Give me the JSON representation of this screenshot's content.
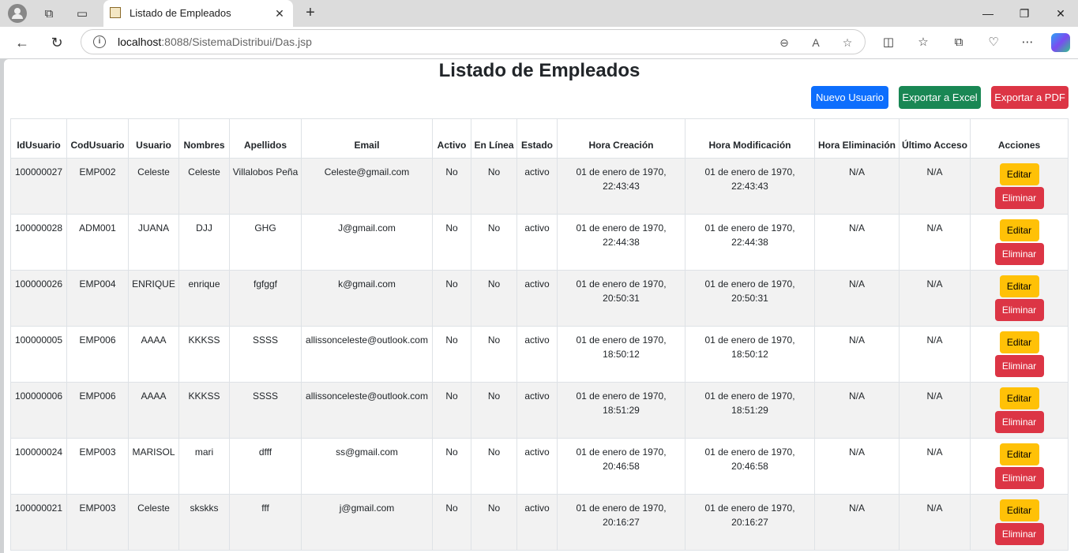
{
  "browser": {
    "tab_title": "Listado de Empleados",
    "new_tab": "+",
    "url_host": "localhost",
    "url_rest": ":8088/SistemaDistribui/Das.jsp"
  },
  "page": {
    "heading": "Listado de Empleados",
    "buttons": {
      "nuevo": "Nuevo Usuario",
      "excel": "Exportar a Excel",
      "pdf": "Exportar a PDF"
    },
    "columns": [
      "IdUsuario",
      "CodUsuario",
      "Usuario",
      "Nombres",
      "Apellidos",
      "Email",
      "Activo",
      "En Línea",
      "Estado",
      "Hora Creación",
      "Hora Modificación",
      "Hora Eliminación",
      "Último Acceso",
      "Acciones"
    ],
    "action_labels": {
      "edit": "Editar",
      "delete": "Eliminar"
    },
    "rows": [
      [
        "100000027",
        "EMP002",
        "Celeste",
        "Celeste",
        "Villalobos Peña",
        "Celeste@gmail.com",
        "No",
        "No",
        "activo",
        "01 de enero de 1970, 22:43:43",
        "01 de enero de 1970, 22:43:43",
        "N/A",
        "N/A"
      ],
      [
        "100000028",
        "ADM001",
        "JUANA",
        "DJJ",
        "GHG",
        "J@gmail.com",
        "No",
        "No",
        "activo",
        "01 de enero de 1970, 22:44:38",
        "01 de enero de 1970, 22:44:38",
        "N/A",
        "N/A"
      ],
      [
        "100000026",
        "EMP004",
        "ENRIQUE",
        "enrique",
        "fgfggf",
        "k@gmail.com",
        "No",
        "No",
        "activo",
        "01 de enero de 1970, 20:50:31",
        "01 de enero de 1970, 20:50:31",
        "N/A",
        "N/A"
      ],
      [
        "100000005",
        "EMP006",
        "AAAA",
        "KKKSS",
        "SSSS",
        "allissonceleste@outlook.com",
        "No",
        "No",
        "activo",
        "01 de enero de 1970, 18:50:12",
        "01 de enero de 1970, 18:50:12",
        "N/A",
        "N/A"
      ],
      [
        "100000006",
        "EMP006",
        "AAAA",
        "KKKSS",
        "SSSS",
        "allissonceleste@outlook.com",
        "No",
        "No",
        "activo",
        "01 de enero de 1970, 18:51:29",
        "01 de enero de 1970, 18:51:29",
        "N/A",
        "N/A"
      ],
      [
        "100000024",
        "EMP003",
        "MARISOL",
        "mari",
        "dfff",
        "ss@gmail.com",
        "No",
        "No",
        "activo",
        "01 de enero de 1970, 20:46:58",
        "01 de enero de 1970, 20:46:58",
        "N/A",
        "N/A"
      ],
      [
        "100000021",
        "EMP003",
        "Celeste",
        "skskks",
        "fff",
        "j@gmail.com",
        "No",
        "No",
        "activo",
        "01 de enero de 1970, 20:16:27",
        "01 de enero de 1970, 20:16:27",
        "N/A",
        "N/A"
      ]
    ]
  }
}
